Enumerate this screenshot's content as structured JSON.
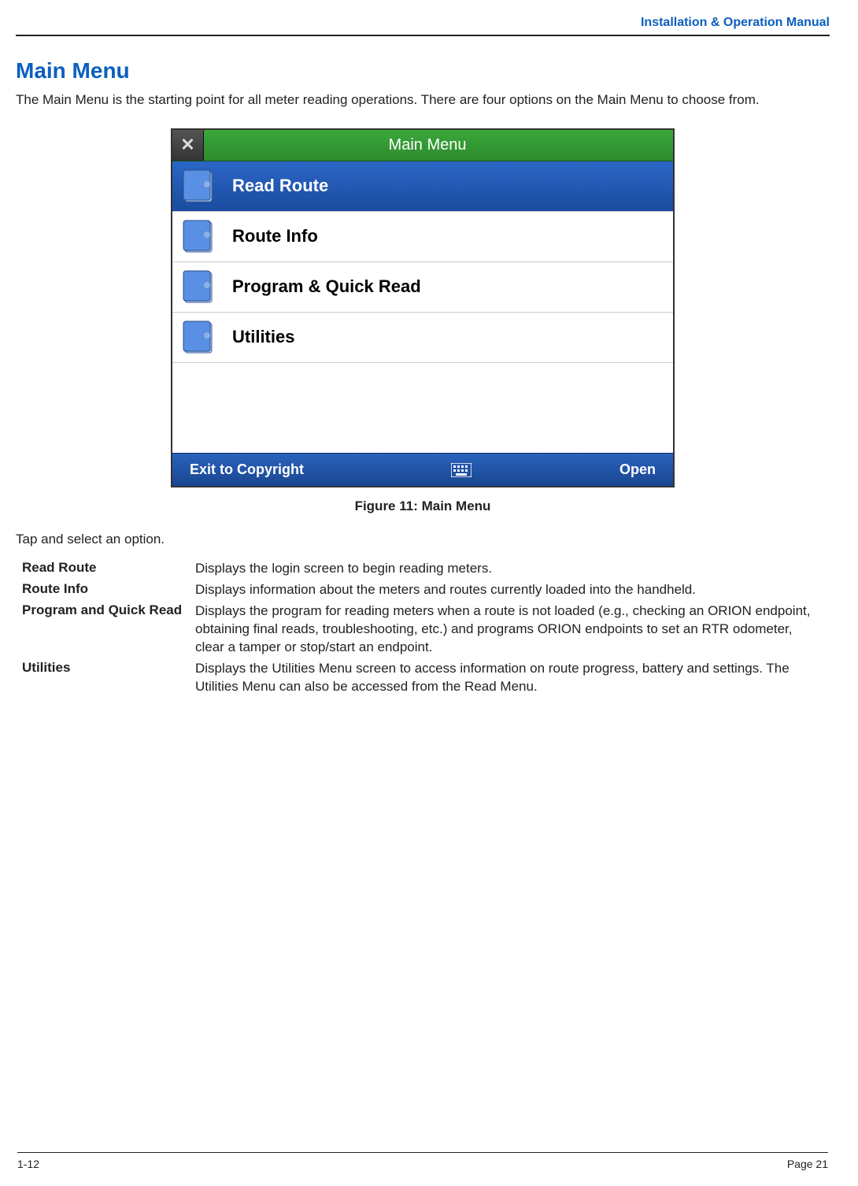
{
  "header": {
    "doc_title": "Installation & Operation Manual"
  },
  "section": {
    "title": "Main Menu",
    "intro": "The Main Menu is the starting point for all meter reading operations. There are four options on the Main Menu to choose from."
  },
  "pda": {
    "close_glyph": "✕",
    "title": "Main Menu",
    "items": [
      {
        "label": "Read Route",
        "selected": true
      },
      {
        "label": "Route Info",
        "selected": false
      },
      {
        "label": "Program & Quick Read",
        "selected": false
      },
      {
        "label": "Utilities",
        "selected": false
      }
    ],
    "bottom_left": "Exit to Copyright",
    "bottom_right": "Open"
  },
  "figure_caption": "Figure 11:  Main Menu",
  "instruction": "Tap and select an option.",
  "definitions": [
    {
      "term": "Read Route",
      "desc": "Displays the login screen to begin reading meters."
    },
    {
      "term": "Route Info",
      "desc": "Displays information about the meters and routes currently loaded into the handheld."
    },
    {
      "term": "Program and Quick Read",
      "desc": "Displays the program for reading meters when a route is not loaded (e.g., checking an ORION endpoint, obtaining final reads, troubleshooting, etc.) and programs ORION endpoints to set an RTR odometer, clear a tamper or stop/start an endpoint."
    },
    {
      "term": "Utilities",
      "desc": "Displays the Utilities Menu screen to access information on route progress, battery and settings. The Utilities Menu can also be accessed from the Read Menu."
    }
  ],
  "footer": {
    "left": "1-12",
    "right": "Page 21"
  }
}
